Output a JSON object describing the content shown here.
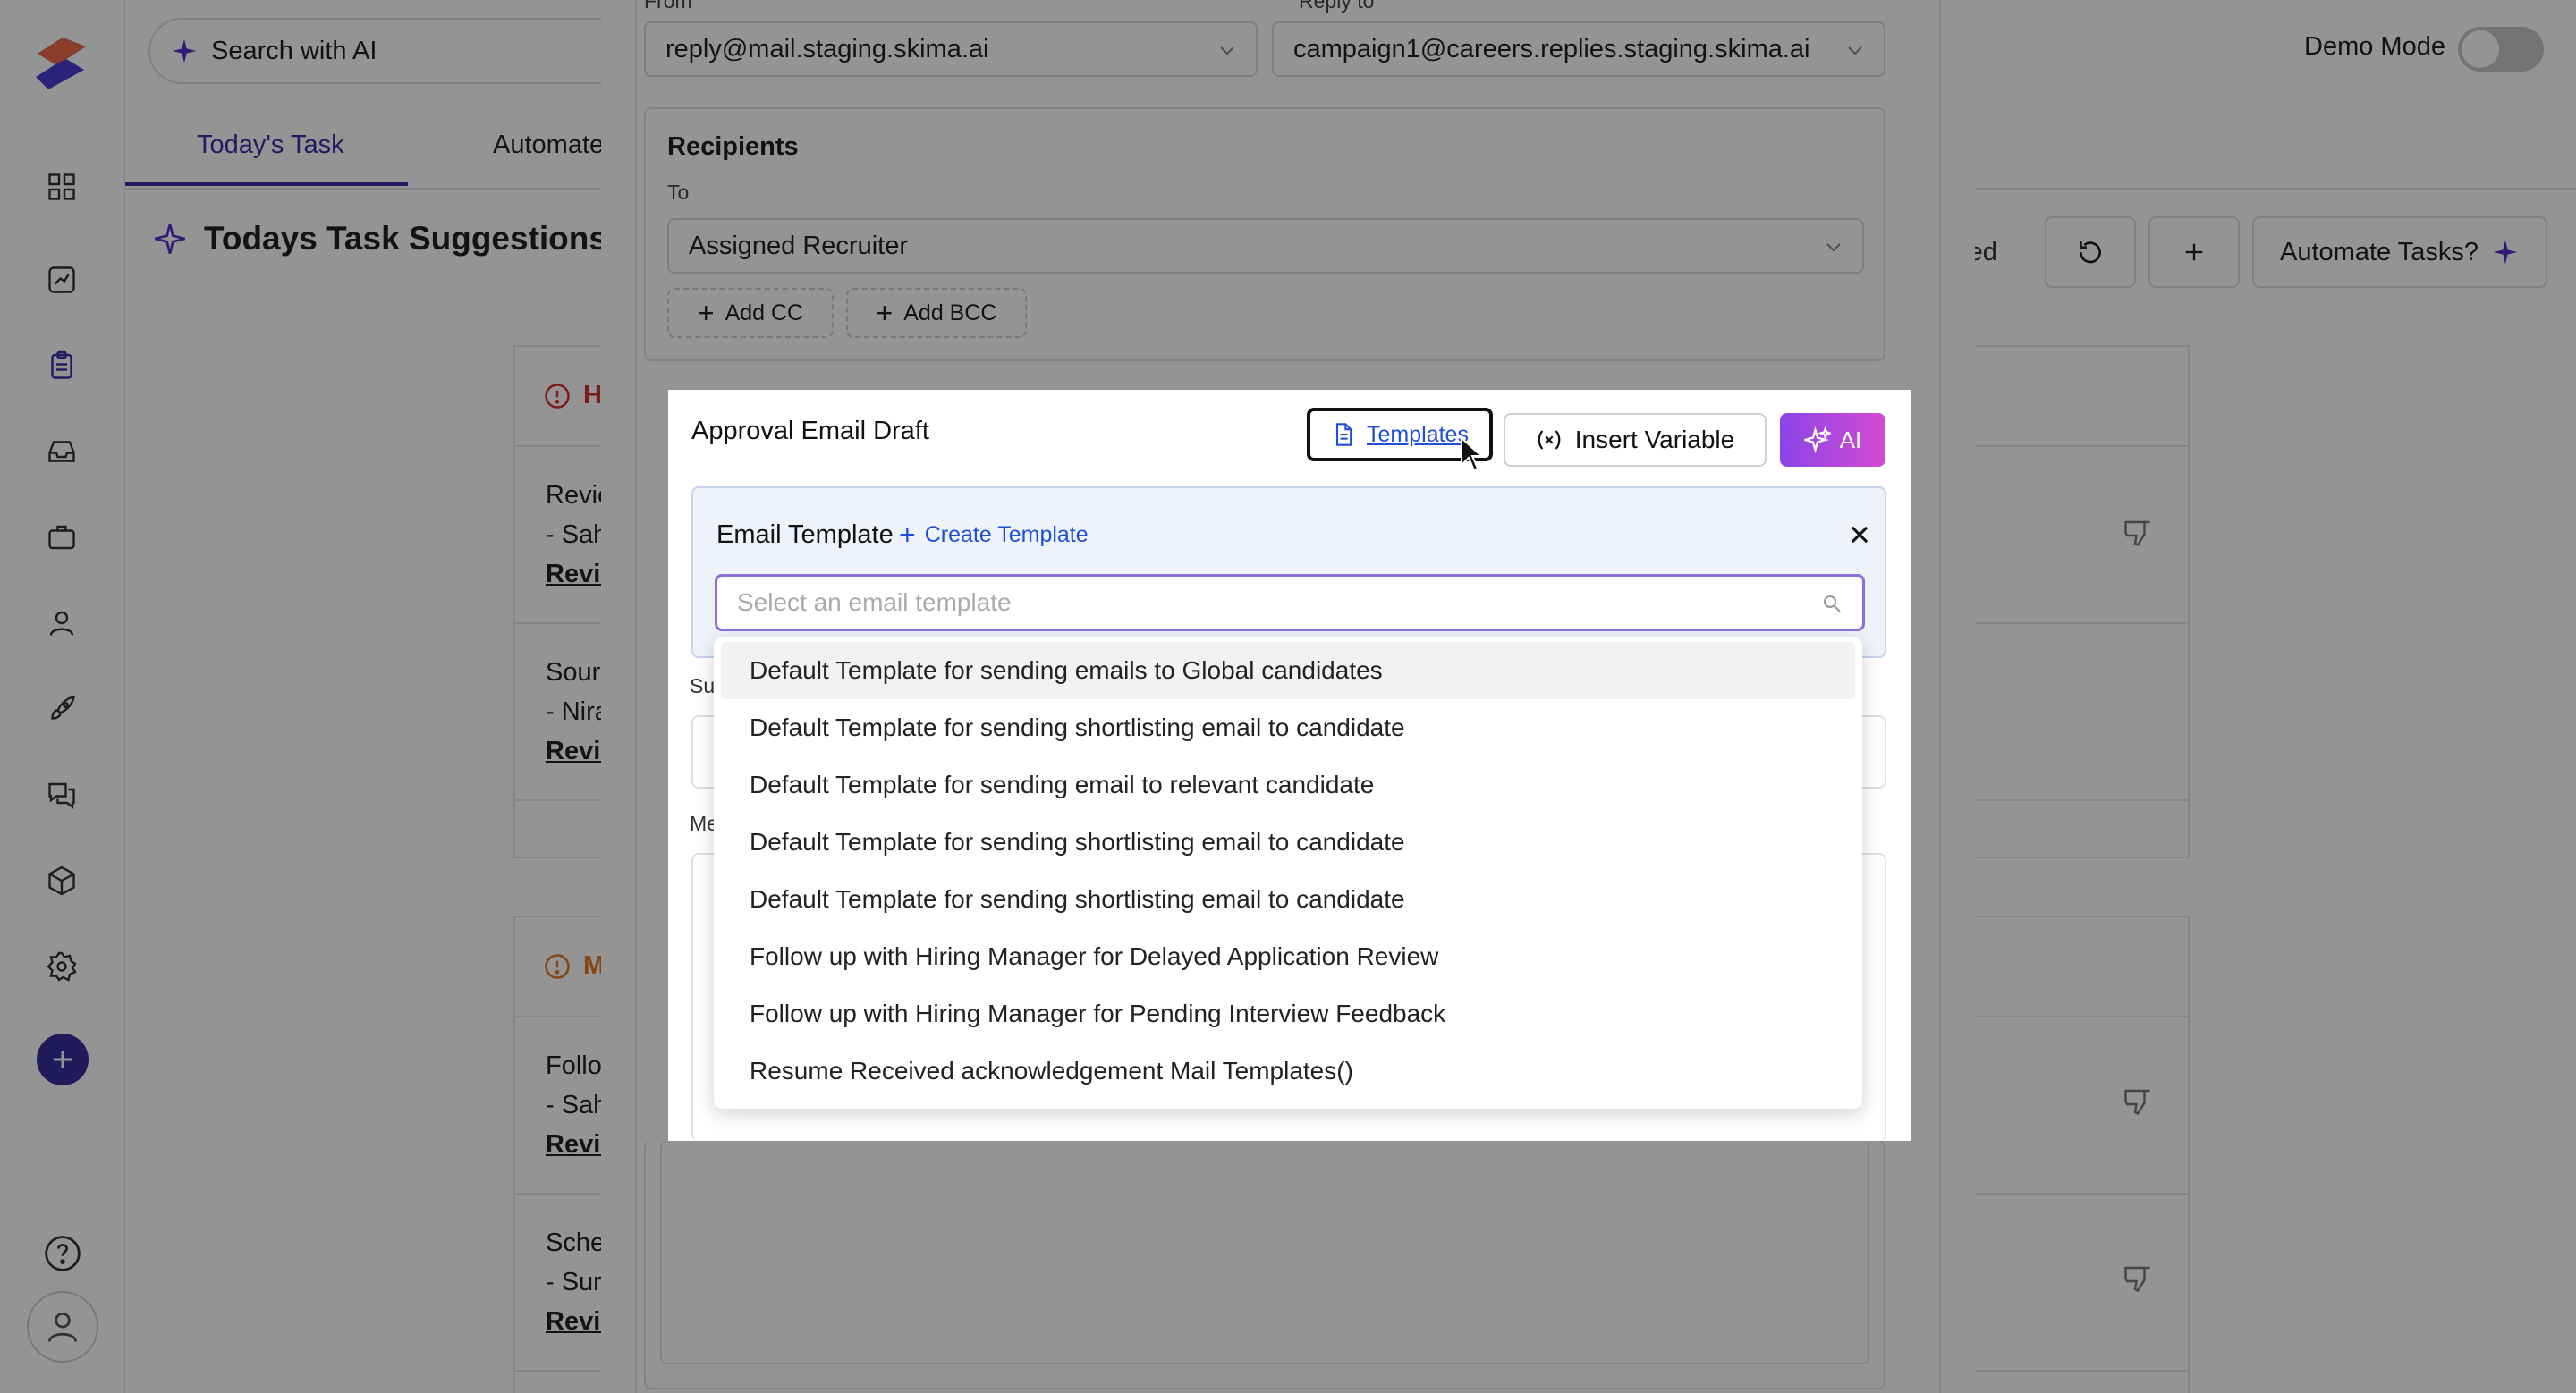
{
  "header": {
    "search_ai_label": "Search with AI",
    "demo_mode_label": "Demo Mode"
  },
  "tabs": [
    {
      "label": "Today's Task"
    },
    {
      "label": "Automate"
    }
  ],
  "page": {
    "title": "Todays Task Suggestions",
    "completed_label": "leted",
    "automate_tasks_label": "Automate Tasks?"
  },
  "cards": {
    "high_label": "H",
    "medium_label": "M",
    "rows": [
      {
        "line1": "Revie",
        "line2": "- Sah",
        "link": "Revie"
      },
      {
        "line1": "Sourc",
        "line2": "- Nira",
        "link": "Revie"
      },
      {
        "line1": "Follo",
        "line2": "- Sah",
        "link": "Revie"
      },
      {
        "line1": "Sche",
        "line2": "- Sure",
        "link": "Revie"
      }
    ]
  },
  "modal": {
    "from_label": "From",
    "reply_to_label": "Reply to",
    "from_value": "reply@mail.staging.skima.ai",
    "reply_to_value": "campaign1@careers.replies.staging.skima.ai",
    "recipients_title": "Recipients",
    "to_label": "To",
    "to_value": "Assigned Recruiter",
    "add_cc_label": "Add CC",
    "add_bcc_label": "Add BCC",
    "subject_label": "Su",
    "message_label": "Me"
  },
  "draft": {
    "title": "Approval Email Draft",
    "templates_label": "Templates",
    "insert_variable_label": "Insert Variable",
    "ai_label": "AI",
    "email_template_label": "Email Template",
    "create_template_label": "Create Template",
    "template_placeholder": "Select an email template",
    "options": [
      "Default Template for sending emails to Global candidates",
      "Default Template for sending shortlisting email to candidate",
      "Default Template for sending email to relevant candidate",
      "Default Template for sending shortlisting email to candidate",
      "Default Template for sending shortlisting email to candidate",
      "Follow up with Hiring Manager for Delayed Application Review",
      "Follow up with Hiring Manager for Pending Interview Feedback",
      "Resume Received acknowledgement Mail Templates()"
    ]
  },
  "colors": {
    "brand": "#3a2fa8",
    "link": "#1f4fd6",
    "ai_gradient_start": "#8b45e8",
    "ai_gradient_end": "#d24bd0",
    "high_priority": "#d7322f",
    "medium_priority": "#e07a1f"
  }
}
